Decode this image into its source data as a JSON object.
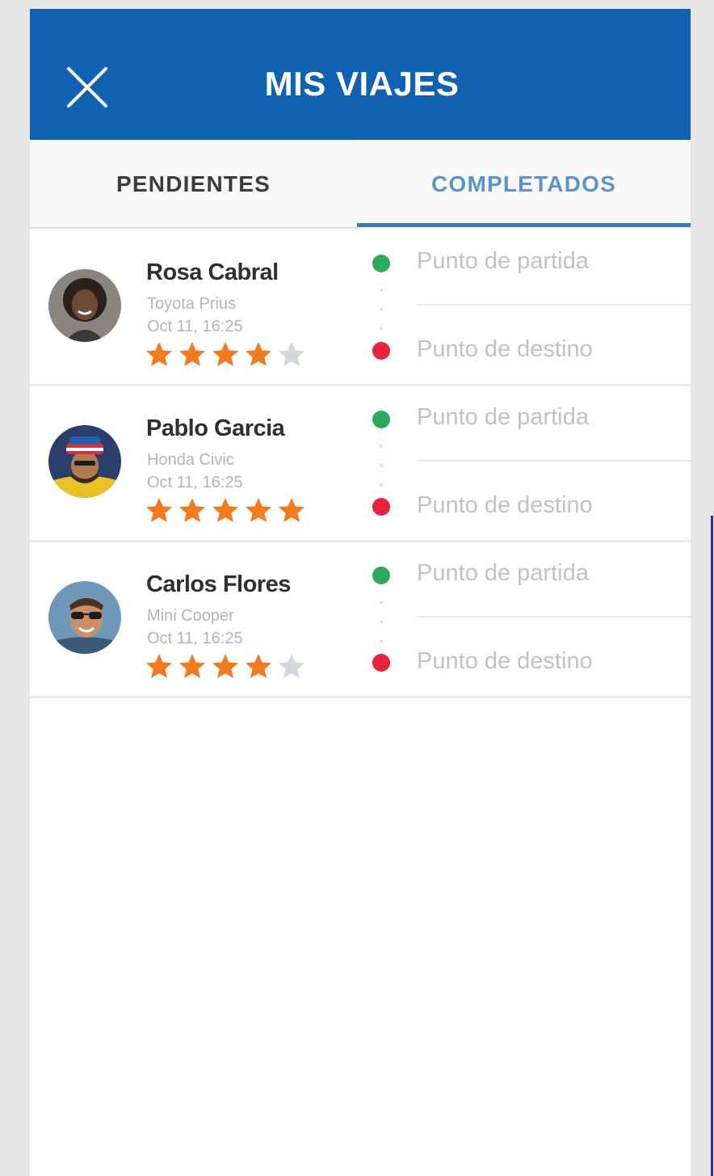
{
  "header": {
    "title": "MIS VIAJES",
    "background": "#1062b0",
    "close_icon": "close-icon"
  },
  "tabs": [
    {
      "label": "PENDIENTES",
      "active": false
    },
    {
      "label": "COMPLETADOS",
      "active": true
    }
  ],
  "colors": {
    "accent": "#3f7bc0",
    "star_filled": "#f47a20",
    "star_empty": "#d3d7e3",
    "start_dot": "#2eaa5c",
    "end_dot": "#e8213a"
  },
  "trips": [
    {
      "name": "Rosa Cabral",
      "car": "Toyota Prius",
      "date": "Oct 11, 16:25",
      "rating": 4,
      "rating_max": 5,
      "avatar": "avatar-photo",
      "start_label": "Punto de partida",
      "end_label": "Punto de destino"
    },
    {
      "name": "Pablo Garcia",
      "car": "Honda Civic",
      "date": "Oct 11, 16:25",
      "rating": 5,
      "rating_max": 5,
      "avatar": "avatar-photo",
      "start_label": "Punto de partida",
      "end_label": "Punto de destino"
    },
    {
      "name": "Carlos Flores",
      "car": "Mini Cooper",
      "date": "Oct 11, 16:25",
      "rating": 4,
      "rating_max": 5,
      "avatar": "avatar-photo",
      "start_label": "Punto de partida",
      "end_label": "Punto de destino"
    }
  ]
}
